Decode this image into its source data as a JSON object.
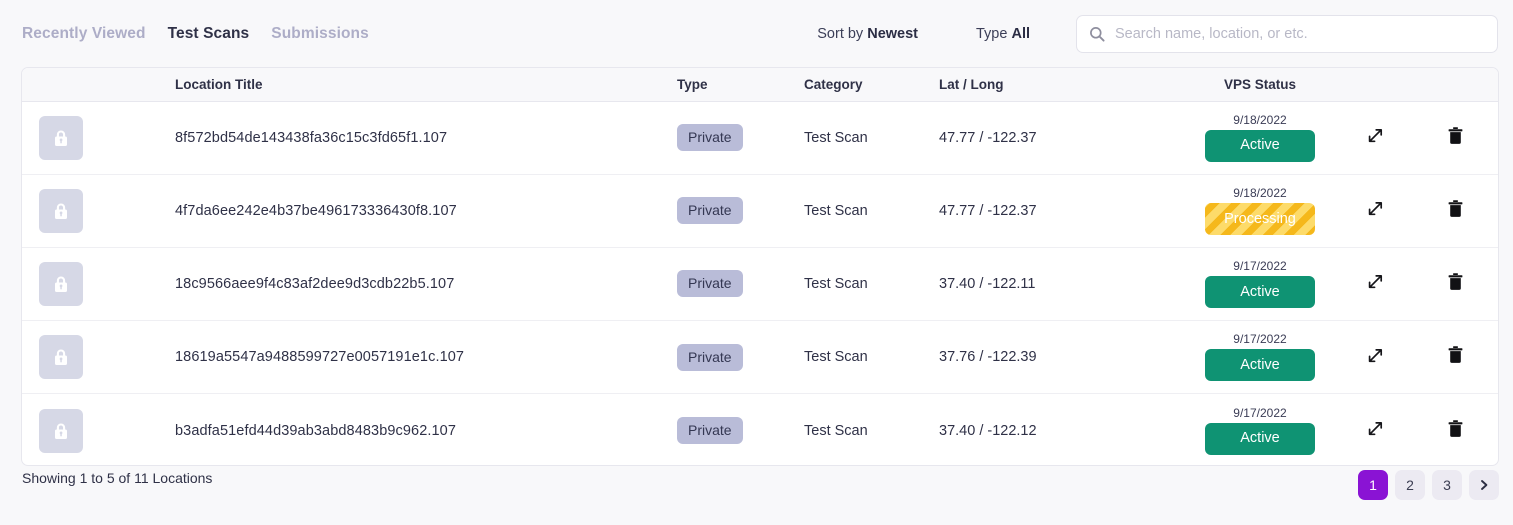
{
  "tabs": [
    {
      "label": "Recently Viewed",
      "active": false
    },
    {
      "label": "Test Scans",
      "active": true
    },
    {
      "label": "Submissions",
      "active": false
    }
  ],
  "controls": {
    "sort_label": "Sort by",
    "sort_value": "Newest",
    "type_label": "Type",
    "type_value": "All"
  },
  "search": {
    "placeholder": "Search name, location, or etc.",
    "value": "",
    "icon": "search-icon"
  },
  "table": {
    "headers": {
      "thumb": "",
      "title": "Location Title",
      "type": "Type",
      "category": "Category",
      "latlong": "Lat / Long",
      "vps": "VPS Status",
      "expand": "",
      "delete": ""
    },
    "rows": [
      {
        "thumb_icon": "lock-icon",
        "title": "8f572bd54de143438fa36c15c3fd65f1.107",
        "type": "Private",
        "category": "Test Scan",
        "latlong": "47.77 / -122.37",
        "vps_date": "9/18/2022",
        "vps_status": "Active",
        "vps_state": "active",
        "expand_icon": "expand-icon",
        "delete_icon": "trash-icon"
      },
      {
        "thumb_icon": "lock-icon",
        "title": "4f7da6ee242e4b37be496173336430f8.107",
        "type": "Private",
        "category": "Test Scan",
        "latlong": "47.77 / -122.37",
        "vps_date": "9/18/2022",
        "vps_status": "Processing",
        "vps_state": "processing",
        "expand_icon": "expand-icon",
        "delete_icon": "trash-icon"
      },
      {
        "thumb_icon": "lock-icon",
        "title": "18c9566aee9f4c83af2dee9d3cdb22b5.107",
        "type": "Private",
        "category": "Test Scan",
        "latlong": "37.40 / -122.11",
        "vps_date": "9/17/2022",
        "vps_status": "Active",
        "vps_state": "active",
        "expand_icon": "expand-icon",
        "delete_icon": "trash-icon"
      },
      {
        "thumb_icon": "lock-icon",
        "title": "18619a5547a9488599727e0057191e1c.107",
        "type": "Private",
        "category": "Test Scan",
        "latlong": "37.76 / -122.39",
        "vps_date": "9/17/2022",
        "vps_status": "Active",
        "vps_state": "active",
        "expand_icon": "expand-icon",
        "delete_icon": "trash-icon"
      },
      {
        "thumb_icon": "lock-icon",
        "title": "b3adfa51efd44d39ab3abd8483b9c962.107",
        "type": "Private",
        "category": "Test Scan",
        "latlong": "37.40 / -122.12",
        "vps_date": "9/17/2022",
        "vps_status": "Active",
        "vps_state": "active",
        "expand_icon": "expand-icon",
        "delete_icon": "trash-icon"
      }
    ]
  },
  "footer": {
    "showing": "Showing 1 to 5 of 11 Locations",
    "pages": [
      "1",
      "2",
      "3"
    ],
    "current_page": "1",
    "next_icon": "chevron-right-icon"
  },
  "colors": {
    "accent_purple": "#8a13d4",
    "status_active": "#0f9373",
    "status_processing": "#f5b81b",
    "badge_private": "#b9bcd8",
    "page_bg": "#f8f8fa"
  }
}
